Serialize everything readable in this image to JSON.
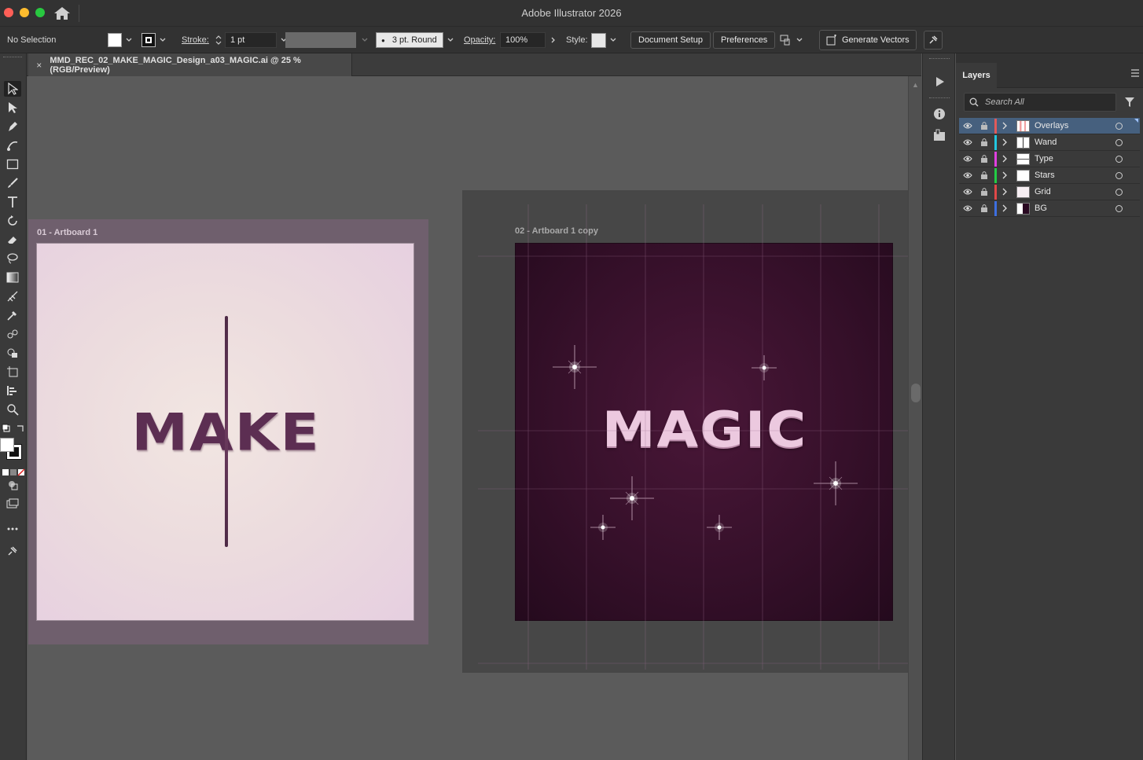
{
  "app": {
    "title": "Adobe Illustrator 2026"
  },
  "controlbar": {
    "selection": "No Selection",
    "stroke_label": "Stroke:",
    "stroke_weight": "1 pt",
    "brush": "3 pt. Round",
    "opacity_label": "Opacity:",
    "opacity_value": "100%",
    "style_label": "Style:",
    "document_setup": "Document Setup",
    "preferences": "Preferences",
    "generate_vectors": "Generate Vectors"
  },
  "document": {
    "tab_title": "MMD_REC_02_MAKE_MAGIC_Design_a03_MAGIC.ai @ 25 % (RGB/Preview)",
    "close": "×"
  },
  "artboards": [
    {
      "label": "01 - Artboard 1",
      "text": "MAKE"
    },
    {
      "label": "02 - Artboard 1 copy",
      "text": "MAGIC"
    }
  ],
  "layers_panel": {
    "tab": "Layers",
    "search_placeholder": "Search All",
    "layers": [
      {
        "name": "Overlays",
        "color": "#e05a5a",
        "active": true
      },
      {
        "name": "Wand",
        "color": "#22c7e0",
        "active": false
      },
      {
        "name": "Type",
        "color": "#e040e0",
        "active": false
      },
      {
        "name": "Stars",
        "color": "#22cc44",
        "active": false
      },
      {
        "name": "Grid",
        "color": "#e04848",
        "active": false
      },
      {
        "name": "BG",
        "color": "#3d6fe0",
        "active": false
      }
    ]
  },
  "colors": {
    "accent": "#46607e",
    "artboard1_text": "#5c2e52",
    "artboard2_bg": "#36102a"
  }
}
